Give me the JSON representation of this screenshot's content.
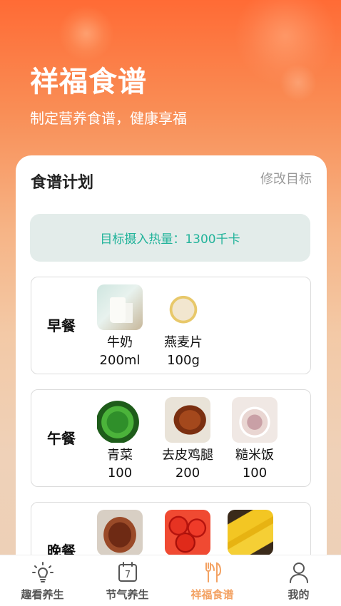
{
  "header": {
    "title": "祥福食谱",
    "subtitle": "制定营养食谱，健康享福"
  },
  "plan": {
    "title": "食谱计划",
    "modify_label": "修改目标",
    "target_text": "目标摄入热量：1300千卡"
  },
  "meals": [
    {
      "name": "早餐",
      "foods": [
        {
          "name": "牛奶",
          "amount": "200ml"
        },
        {
          "name": "燕麦片",
          "amount": "100g"
        }
      ]
    },
    {
      "name": "午餐",
      "foods": [
        {
          "name": "青菜",
          "amount": "100"
        },
        {
          "name": "去皮鸡腿",
          "amount": "200"
        },
        {
          "name": "糙米饭",
          "amount": "100"
        }
      ]
    },
    {
      "name": "晚餐",
      "foods": [
        {
          "name": "",
          "amount": ""
        },
        {
          "name": "",
          "amount": ""
        },
        {
          "name": "",
          "amount": ""
        }
      ]
    }
  ],
  "tabs": [
    {
      "label": "趣看养生",
      "icon": "bulb-icon"
    },
    {
      "label": "节气养生",
      "icon": "calendar-icon",
      "icon_text": "7"
    },
    {
      "label": "祥福食谱",
      "icon": "fork-knife-icon",
      "active": true
    },
    {
      "label": "我的",
      "icon": "user-icon"
    }
  ],
  "colors": {
    "accent": "#f3a263",
    "target_text": "#21b39a",
    "header_top": "#ff6b35"
  }
}
